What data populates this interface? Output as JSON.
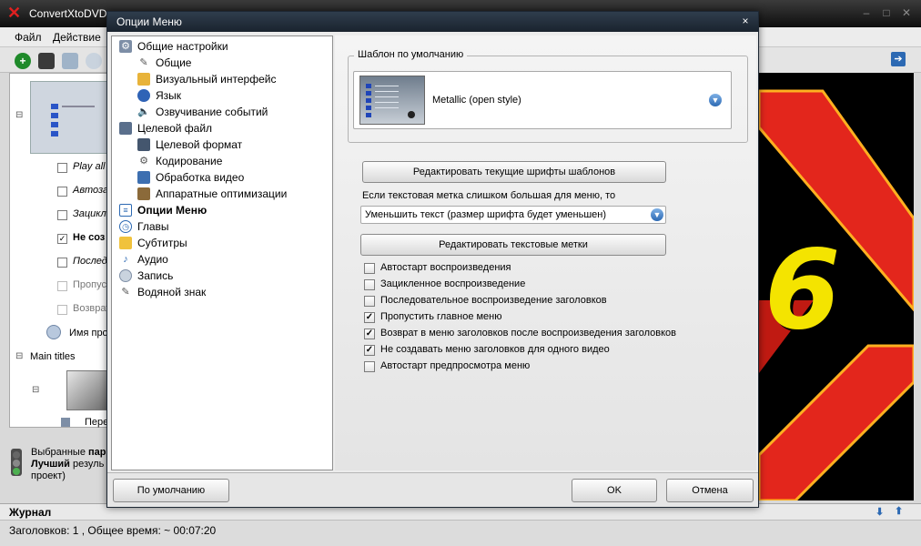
{
  "app": {
    "title": "ConvertXtoDVD",
    "menu": [
      "Файл",
      "Действие"
    ],
    "left_panel": {
      "rows": [
        "Play all",
        "Автоза",
        "Зацикл",
        "Не соз",
        "Послед",
        "Пропус",
        "Возврат",
        "Имя про"
      ],
      "main_titles": "Main titles",
      "sub_row": "Пере"
    },
    "info": {
      "line1_prefix": "Выбранные ",
      "line1_bold": "пар",
      "line2_bold": "Лучший",
      "line2_rest": " резуль",
      "line3": "проект)"
    },
    "journal": "Журнал",
    "status": "Заголовков: 1 , Общее время: ~ 00:07:20",
    "preview_digit": "6"
  },
  "dialog": {
    "title": "Опции Меню",
    "close": "×",
    "nav": [
      {
        "label": "Общие настройки",
        "icon": "gear-group-icon",
        "level": 0
      },
      {
        "label": "Общие",
        "icon": "wrench-icon",
        "level": 1
      },
      {
        "label": "Визуальный интерфейс",
        "icon": "palette-icon",
        "level": 1
      },
      {
        "label": "Язык",
        "icon": "globe-icon",
        "level": 1
      },
      {
        "label": "Озвучивание событий",
        "icon": "speaker-icon",
        "level": 1
      },
      {
        "label": "Целевой файл",
        "icon": "monitor-icon",
        "level": 0
      },
      {
        "label": "Целевой формат",
        "icon": "screen-icon",
        "level": 1
      },
      {
        "label": "Кодирование",
        "icon": "gear-icon",
        "level": 1
      },
      {
        "label": "Обработка видео",
        "icon": "film-icon",
        "level": 1
      },
      {
        "label": "Аппаратные оптимизации",
        "icon": "chip-icon",
        "level": 1
      },
      {
        "label": "Опции Меню",
        "icon": "menu-icon",
        "level": 0,
        "selected": true
      },
      {
        "label": "Главы",
        "icon": "clock-icon",
        "level": 0
      },
      {
        "label": "Субтитры",
        "icon": "subtitle-icon",
        "level": 0
      },
      {
        "label": "Аудио",
        "icon": "note-icon",
        "level": 0
      },
      {
        "label": "Запись",
        "icon": "disc-icon",
        "level": 0
      },
      {
        "label": "Водяной знак",
        "icon": "watermark-icon",
        "level": 0
      }
    ],
    "template_group_caption": "Шаблон по умолчанию",
    "template_name": "Metallic (open style)",
    "edit_fonts_button": "Редактировать текущие шрифты шаблонов",
    "overflow_hint": "Если текстовая метка слишком большая для меню, то",
    "overflow_option": "Уменьшить текст (размер шрифта будет уменьшен)",
    "edit_labels_button": "Редактировать текстовые метки",
    "options": [
      {
        "label": "Автостарт воспроизведения",
        "checked": false
      },
      {
        "label": "Зацикленное воспроизведение",
        "checked": false
      },
      {
        "label": "Последовательное воспроизведение заголовков",
        "checked": false
      },
      {
        "label": "Пропустить главное меню",
        "checked": true
      },
      {
        "label": "Возврат в меню заголовков после воспроизведения заголовков",
        "checked": true
      },
      {
        "label": "Не создавать меню заголовков для одного видео",
        "checked": true
      },
      {
        "label": "Автостарт предпросмотра меню",
        "checked": false
      }
    ],
    "default_button": "По умолчанию",
    "ok_button": "OK",
    "cancel_button": "Отмена"
  },
  "colors": {
    "accent_blue": "#2c69b3",
    "preview_red": "#e3261c",
    "preview_yellow": "#f4e400"
  }
}
